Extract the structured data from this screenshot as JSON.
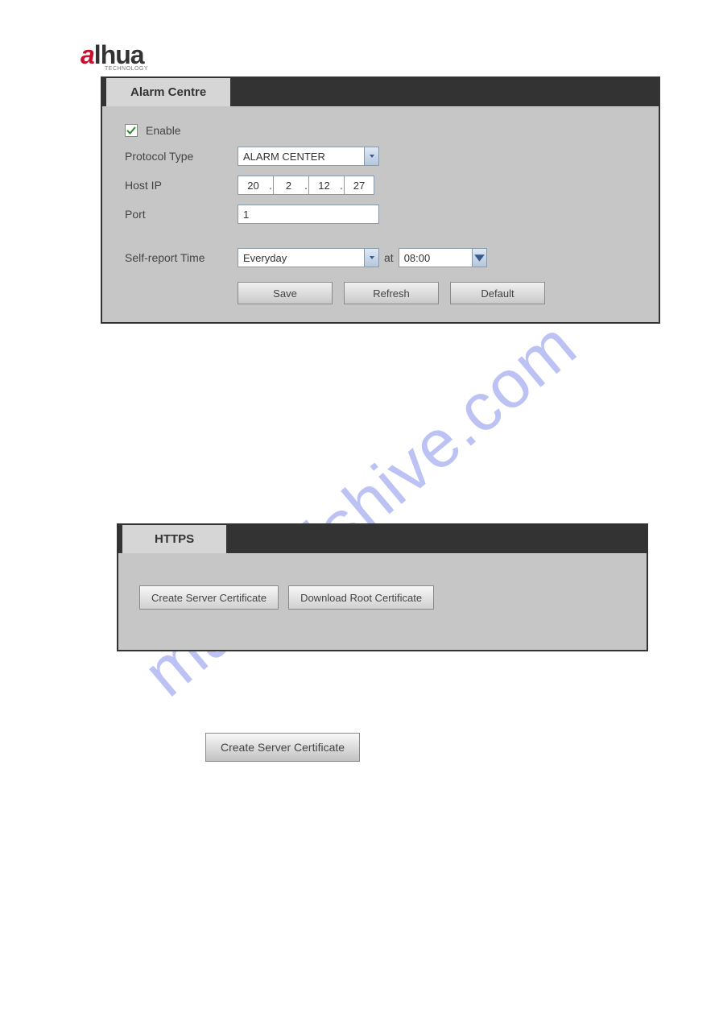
{
  "brand": {
    "name": "alhua",
    "sub": "TECHNOLOGY"
  },
  "watermark": "manualshive.com",
  "panel1": {
    "tab": "Alarm Centre",
    "enable_label": "Enable",
    "enable_checked": true,
    "protocol_label": "Protocol Type",
    "protocol_value": "ALARM CENTER",
    "hostip_label": "Host IP",
    "hostip": [
      "20",
      "2",
      "12",
      "27"
    ],
    "port_label": "Port",
    "port_value": "1",
    "selfreport_label": "Self-report Time",
    "selfreport_day": "Everyday",
    "at_label": "at",
    "selfreport_time": "08:00",
    "buttons": {
      "save": "Save",
      "refresh": "Refresh",
      "default": "Default"
    }
  },
  "panel2": {
    "tab": "HTTPS",
    "create_cert": "Create Server Certificate",
    "download_root": "Download Root Certificate"
  },
  "standalone": {
    "create_cert": "Create Server Certificate"
  }
}
